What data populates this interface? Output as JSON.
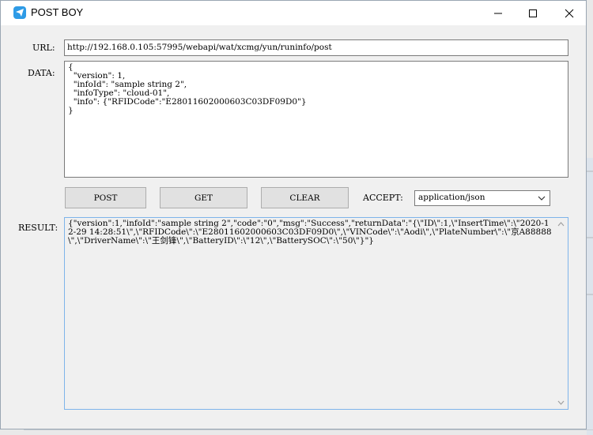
{
  "window": {
    "title": "POST BOY",
    "colors": {
      "accent": "#2e9be6",
      "background": "#f0f0f0",
      "titlebar": "#ffffff"
    }
  },
  "form": {
    "url_label": "URL:",
    "url_value": "http://192.168.0.105:57995/webapi/wat/xcmg/yun/runinfo/post",
    "data_label": "DATA:",
    "data_value": "{\n  \"version\": 1,\n  \"infoId\": \"sample string 2\",\n  \"infoType\": \"cloud-01\",\n  \"info\": {\"RFIDCode\":\"E28011602000603C03DF09D0\"}\n}",
    "result_label": "RESULT:",
    "result_value": "{\"version\":1,\"infoId\":\"sample string 2\",\"code\":\"0\",\"msg\":\"Success\",\"returnData\":\"{\\\"ID\\\":1,\\\"InsertTime\\\":\\\"2020-12-29 14:28:51\\\",\\\"RFIDCode\\\":\\\"E28011602000603C03DF09D0\\\",\\\"VINCode\\\":\\\"Aodi\\\",\\\"PlateNumber\\\":\\\"京A88888\\\",\\\"DriverName\\\":\\\"王剑锋\\\",\\\"BatteryID\\\":\\\"12\\\",\\\"BatterySOC\\\":\\\"50\\\"}\"}"
  },
  "toolbar": {
    "post_label": "POST",
    "get_label": "GET",
    "clear_label": "CLEAR",
    "accept_label": "ACCEPT:",
    "accept_value": "application/json"
  },
  "icons": {
    "app": "paper-plane-icon",
    "minimize": "minimize-icon",
    "maximize": "maximize-icon",
    "close": "close-icon",
    "dropdown": "chevron-down-icon"
  }
}
